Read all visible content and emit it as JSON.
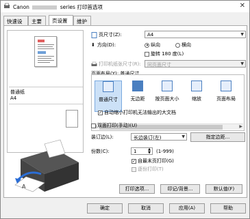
{
  "title": {
    "brand": "Canon",
    "suffix": "series 打印首选项"
  },
  "tabs": [
    "快速设置",
    "主要",
    "页设置",
    "维护"
  ],
  "preview": {
    "media": "普通纸",
    "size": "A4"
  },
  "page_size": {
    "label": "页尺寸(Z):",
    "value": "A4"
  },
  "orientation": {
    "label": "方向(D):",
    "portrait": "纵向",
    "landscape": "横向",
    "rotate": "旋转 180 度(L)"
  },
  "printer_paper": {
    "label": "打印机纸张尺寸(R):",
    "value": "同页面尺寸"
  },
  "layout": {
    "label": "页面布局(Y): 普通尺寸",
    "items": [
      "普通尺寸",
      "无边距",
      "按页面大小",
      "缩放",
      "页面布局"
    ]
  },
  "auto_reduce": "自动缩小打印机无法输出的大文档",
  "duplex": {
    "label": "双面打印(手动)(U)"
  },
  "binding": {
    "label": "装订边(L):",
    "value": "长边装订(左)",
    "button": "指定边距..."
  },
  "copies": {
    "label": "份数(C):",
    "value": "1",
    "range": "(1-999)",
    "from_last": "自最末页打印(G)",
    "collate": "逐份打印(T)"
  },
  "bottom_buttons": {
    "print_options": "打印选项...",
    "stamp": "印记/背景...",
    "defaults": "默认值(F)"
  },
  "dialog_buttons": {
    "ok": "确定",
    "cancel": "取消",
    "apply": "应用(A)",
    "help": "帮助"
  },
  "colors": {
    "accent": "#4a7fc0",
    "selected": "#cce1f7"
  }
}
